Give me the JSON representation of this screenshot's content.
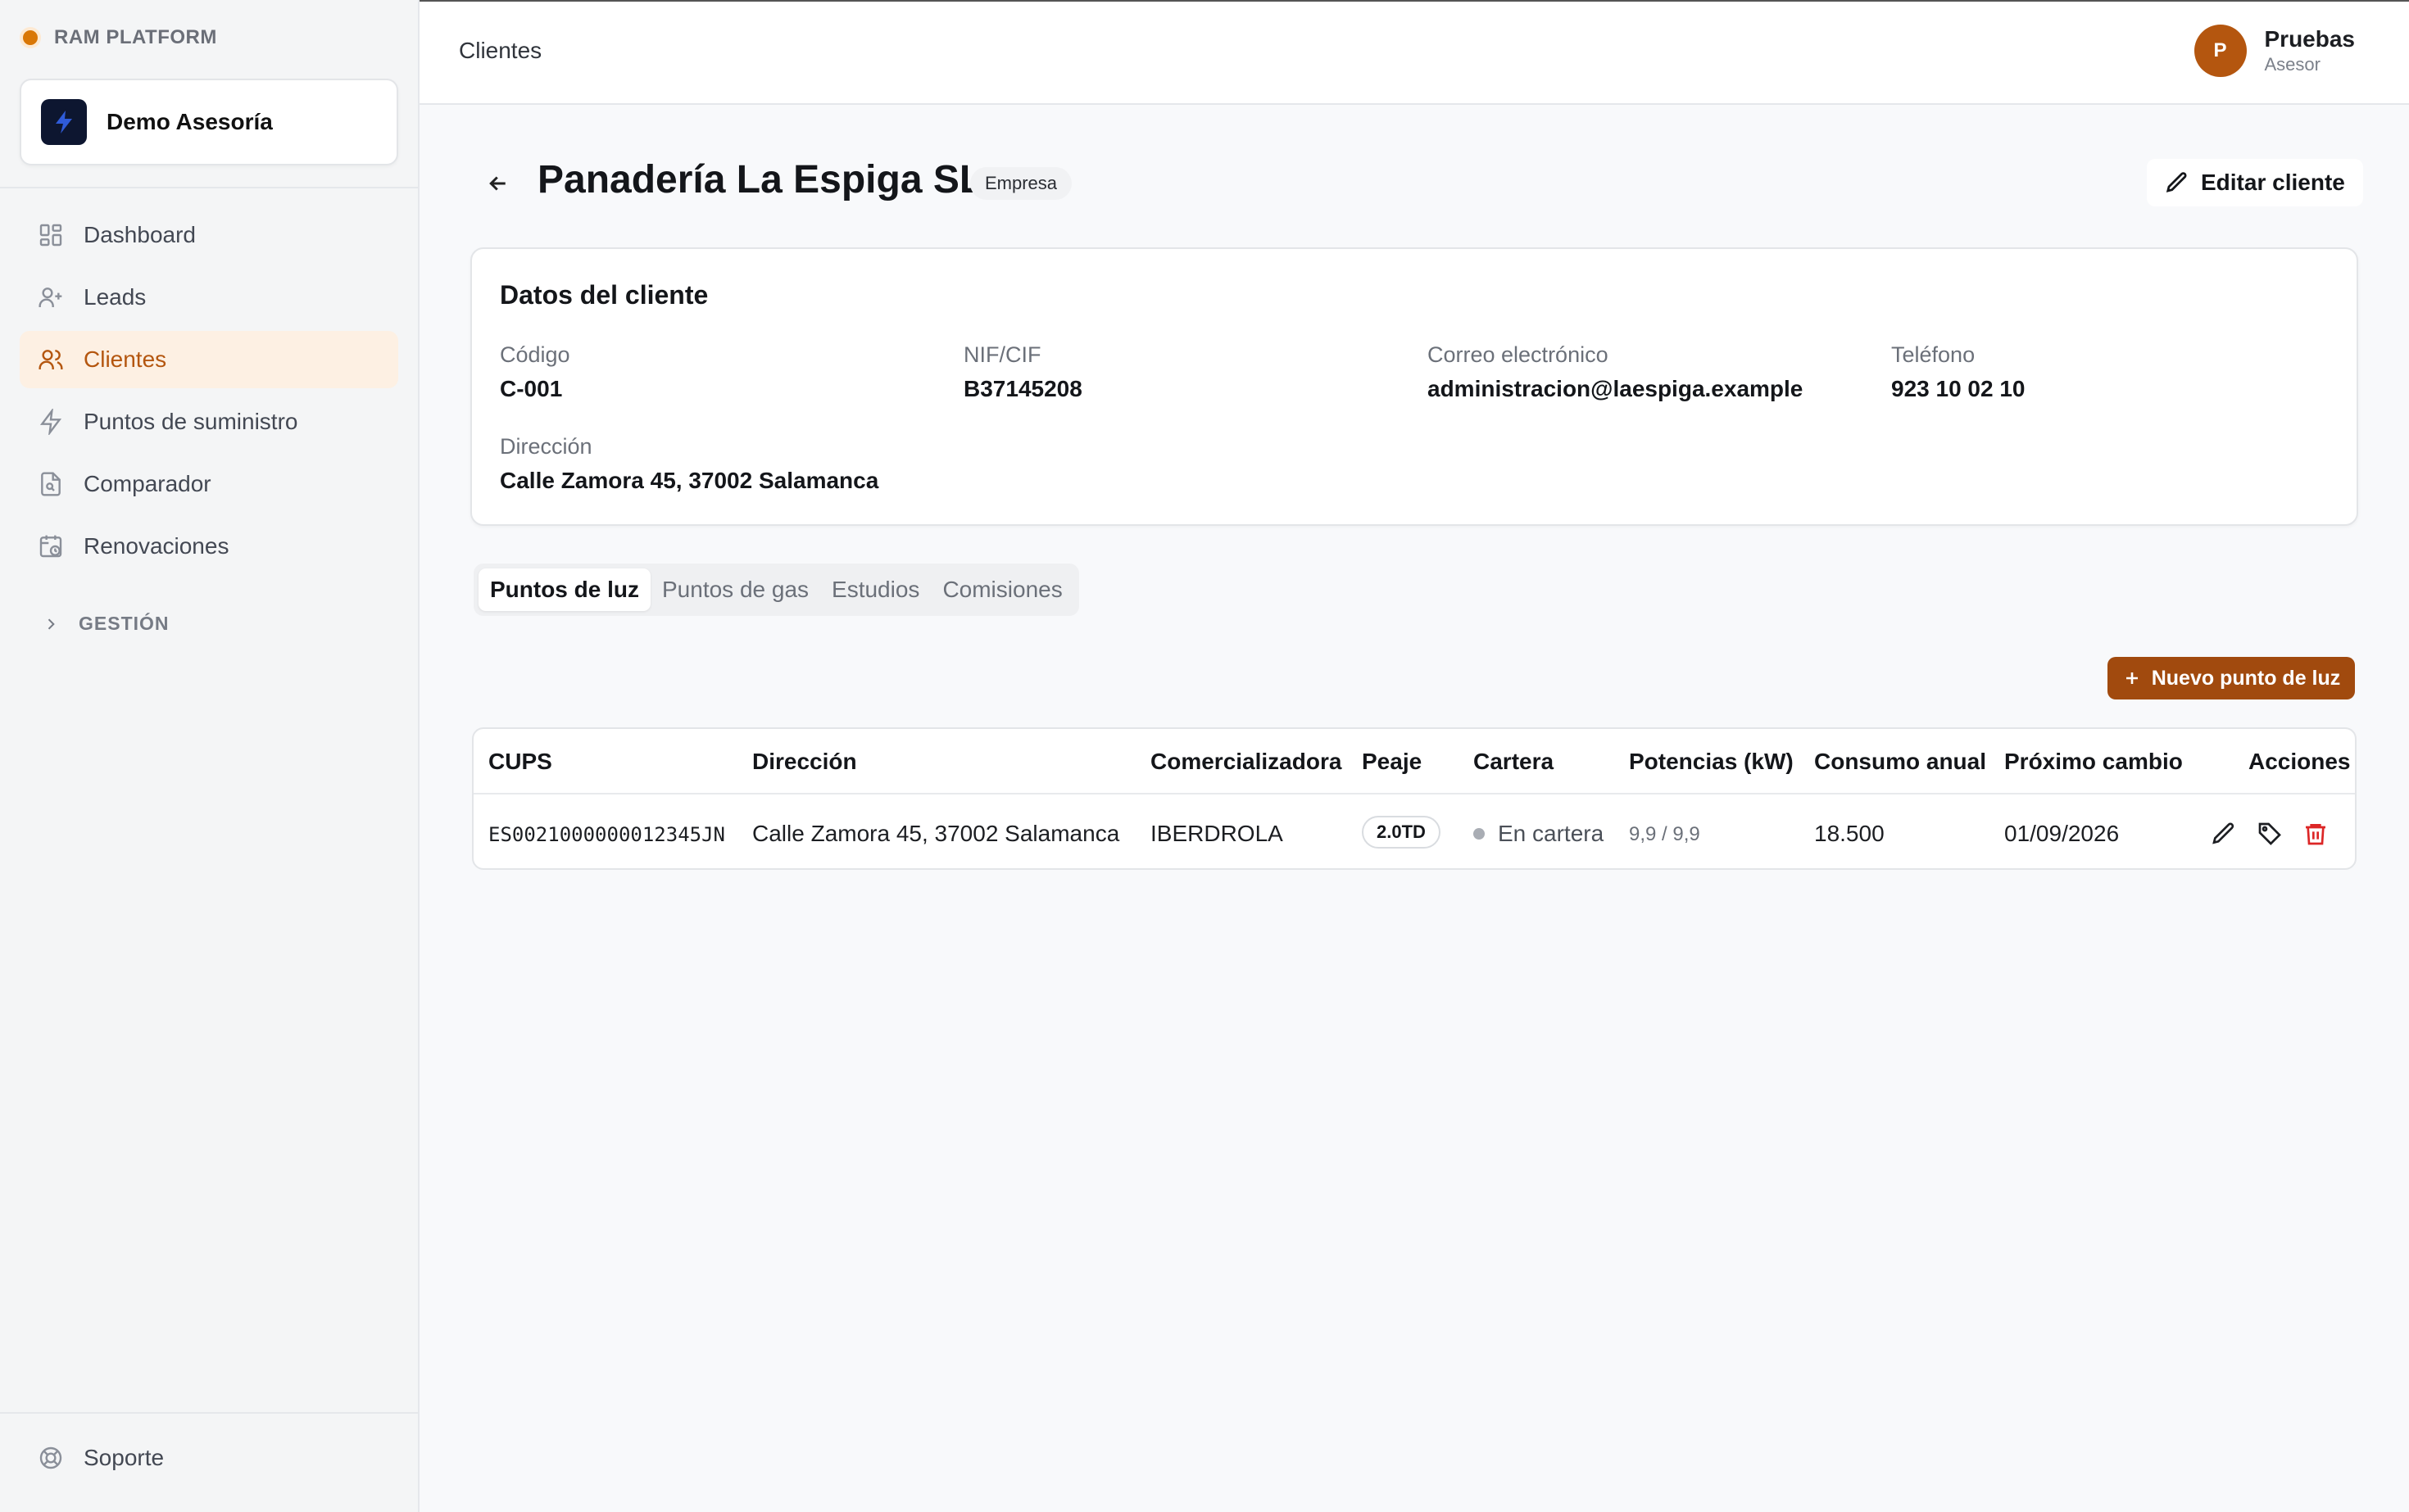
{
  "sidebar": {
    "brand": "RAM PLATFORM",
    "workspace": "Demo Asesoría",
    "items": [
      {
        "label": "Dashboard",
        "icon": "dashboard-icon"
      },
      {
        "label": "Leads",
        "icon": "user-plus-icon"
      },
      {
        "label": "Clientes",
        "icon": "users-icon",
        "active": true
      },
      {
        "label": "Puntos de suministro",
        "icon": "lightning-icon"
      },
      {
        "label": "Comparador",
        "icon": "file-search-icon"
      },
      {
        "label": "Renovaciones",
        "icon": "calendar-clock-icon"
      }
    ],
    "group": "GESTIÓN",
    "support": "Soporte"
  },
  "topbar": {
    "breadcrumb": "Clientes",
    "user_initial": "P",
    "user_name": "Pruebas",
    "user_role": "Asesor"
  },
  "page": {
    "title": "Panadería La Espiga SL",
    "type_badge": "Empresa",
    "edit_label": "Editar cliente"
  },
  "client_card": {
    "title": "Datos del cliente",
    "fields": [
      {
        "label": "Código",
        "value": "C-001"
      },
      {
        "label": "NIF/CIF",
        "value": "B37145208"
      },
      {
        "label": "Correo electrónico",
        "value": "administracion@laespiga.example"
      },
      {
        "label": "Teléfono",
        "value": "923 10 02 10"
      },
      {
        "label": "Dirección",
        "value": "Calle Zamora 45, 37002 Salamanca"
      }
    ]
  },
  "tabs": [
    {
      "label": "Puntos de luz",
      "active": true
    },
    {
      "label": "Puntos de gas"
    },
    {
      "label": "Estudios"
    },
    {
      "label": "Comisiones"
    }
  ],
  "new_point_label": "Nuevo punto de luz",
  "table": {
    "headers": [
      "CUPS",
      "Dirección",
      "Comercializadora",
      "Peaje",
      "Cartera",
      "Potencias (kW)",
      "Consumo anual",
      "Próximo cambio",
      "Acciones"
    ],
    "rows": [
      {
        "cups": "ES0021000000012345JN",
        "address": "Calle Zamora 45, 37002 Salamanca",
        "retailer": "IBERDROLA",
        "toll": "2.0TD",
        "portfolio": "En cartera",
        "powers": "9,9 / 9,9",
        "annual_consumption": "18.500",
        "next_change": "01/09/2026"
      }
    ]
  },
  "colors": {
    "accent": "#b4560f",
    "primary_button": "#a14a0e",
    "delete": "#dc2626"
  }
}
